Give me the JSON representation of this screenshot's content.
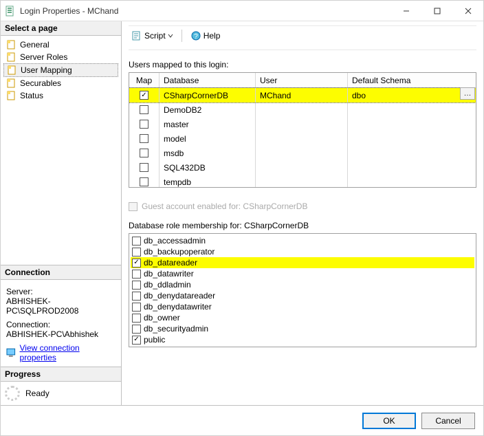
{
  "window": {
    "title": "Login Properties - MChand"
  },
  "sidebar": {
    "select_header": "Select a page",
    "pages": [
      {
        "label": "General"
      },
      {
        "label": "Server Roles"
      },
      {
        "label": "User Mapping"
      },
      {
        "label": "Securables"
      },
      {
        "label": "Status"
      }
    ],
    "connection_header": "Connection",
    "server_label": "Server:",
    "server_value": "ABHISHEK-PC\\SQLPROD2008",
    "conn_label": "Connection:",
    "conn_value": "ABHISHEK-PC\\Abhishek",
    "view_conn_link": "View connection properties",
    "progress_header": "Progress",
    "progress_status": "Ready"
  },
  "toolbar": {
    "script": "Script",
    "help": "Help"
  },
  "mapping": {
    "label": "Users mapped to this login:",
    "columns": {
      "map": "Map",
      "db": "Database",
      "user": "User",
      "schema": "Default Schema"
    },
    "rows": [
      {
        "checked": true,
        "db": "CSharpCornerDB",
        "user": "MChand",
        "schema": "dbo",
        "highlight": true
      },
      {
        "checked": false,
        "db": "DemoDB2",
        "user": "",
        "schema": ""
      },
      {
        "checked": false,
        "db": "master",
        "user": "",
        "schema": ""
      },
      {
        "checked": false,
        "db": "model",
        "user": "",
        "schema": ""
      },
      {
        "checked": false,
        "db": "msdb",
        "user": "",
        "schema": ""
      },
      {
        "checked": false,
        "db": "SQL432DB",
        "user": "",
        "schema": ""
      },
      {
        "checked": false,
        "db": "tempdb",
        "user": "",
        "schema": ""
      }
    ]
  },
  "guest": {
    "label": "Guest account enabled for: CSharpCornerDB"
  },
  "roles": {
    "label": "Database role membership for: CSharpCornerDB",
    "items": [
      {
        "name": "db_accessadmin",
        "checked": false
      },
      {
        "name": "db_backupoperator",
        "checked": false
      },
      {
        "name": "db_datareader",
        "checked": true,
        "highlight": true
      },
      {
        "name": "db_datawriter",
        "checked": false
      },
      {
        "name": "db_ddladmin",
        "checked": false
      },
      {
        "name": "db_denydatareader",
        "checked": false
      },
      {
        "name": "db_denydatawriter",
        "checked": false
      },
      {
        "name": "db_owner",
        "checked": false
      },
      {
        "name": "db_securityadmin",
        "checked": false
      },
      {
        "name": "public",
        "checked": true
      }
    ]
  },
  "footer": {
    "ok": "OK",
    "cancel": "Cancel"
  }
}
